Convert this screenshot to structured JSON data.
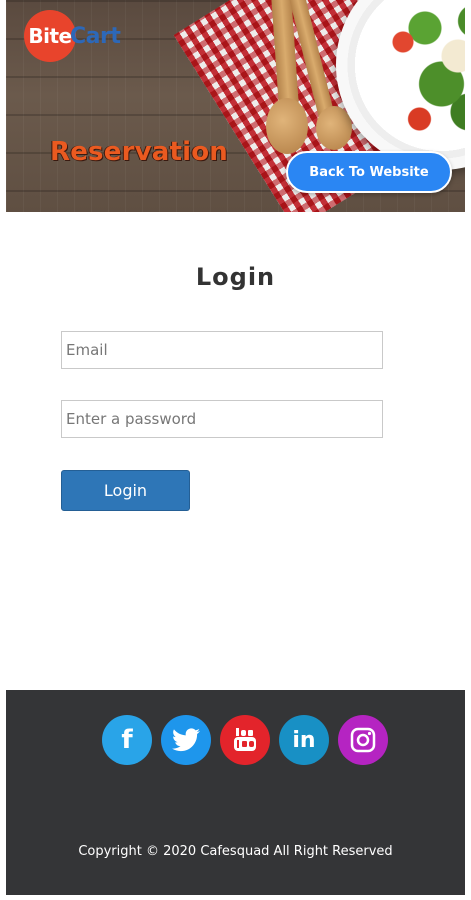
{
  "brand": {
    "logo_left": "Bite",
    "logo_right": "Cart"
  },
  "hero": {
    "title": "Reservation",
    "back_button": "Back To Website"
  },
  "login": {
    "heading": "Login",
    "email_placeholder": "Email",
    "password_placeholder": "Enter a password",
    "submit_label": "Login"
  },
  "footer": {
    "socials": [
      "facebook-icon",
      "twitter-icon",
      "youtube-icon",
      "linkedin-icon",
      "instagram-icon"
    ],
    "copyright": "Copyright © 2020 Cafesquad All Right Reserved"
  },
  "colors": {
    "accent": "#2a86f3",
    "login_button": "#2e76b7",
    "footer_bg": "#343537",
    "hero_title": "#ea5a20"
  }
}
